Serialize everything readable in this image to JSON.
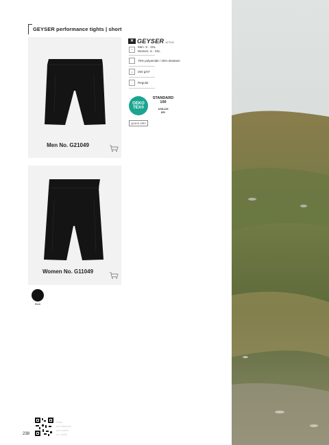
{
  "header": {
    "title": "GEYSER performance tights | short"
  },
  "products": [
    {
      "label": "Men No. G21049"
    },
    {
      "label": "Women No. G11049"
    }
  ],
  "brand": {
    "name": "GEYSER",
    "sub": "ACTIVE"
  },
  "specs": {
    "sizes": {
      "icon": "size-chart-icon",
      "line1": "Men: S - 3XL",
      "line2": "Women: S - 3XL"
    },
    "material": {
      "icon": "fabric-icon",
      "text": "75% polyamide / 25% elastane"
    },
    "weight": {
      "icon": "weight-icon",
      "text": "250 g/m²"
    },
    "fit": {
      "icon": "fit-icon",
      "text": "Regular"
    }
  },
  "certification": {
    "logo_line1": "OEKO",
    "logo_line2": "TEX®",
    "standard_line1": "STANDARD",
    "standard_line2": "100",
    "code_line1": "1376-215",
    "code_line2": "EPI",
    "color": "#1aa58f"
  },
  "badge": {
    "text": "QUICK DRY"
  },
  "colors": [
    {
      "name": "Black",
      "hex": "#111111"
    }
  ],
  "footer": {
    "qr_text_line1": "Scan",
    "qr_text_line2": "and discover",
    "qr_text_line3": "all models",
    "qr_text_line4": "on JAMA",
    "page_number": "238"
  }
}
